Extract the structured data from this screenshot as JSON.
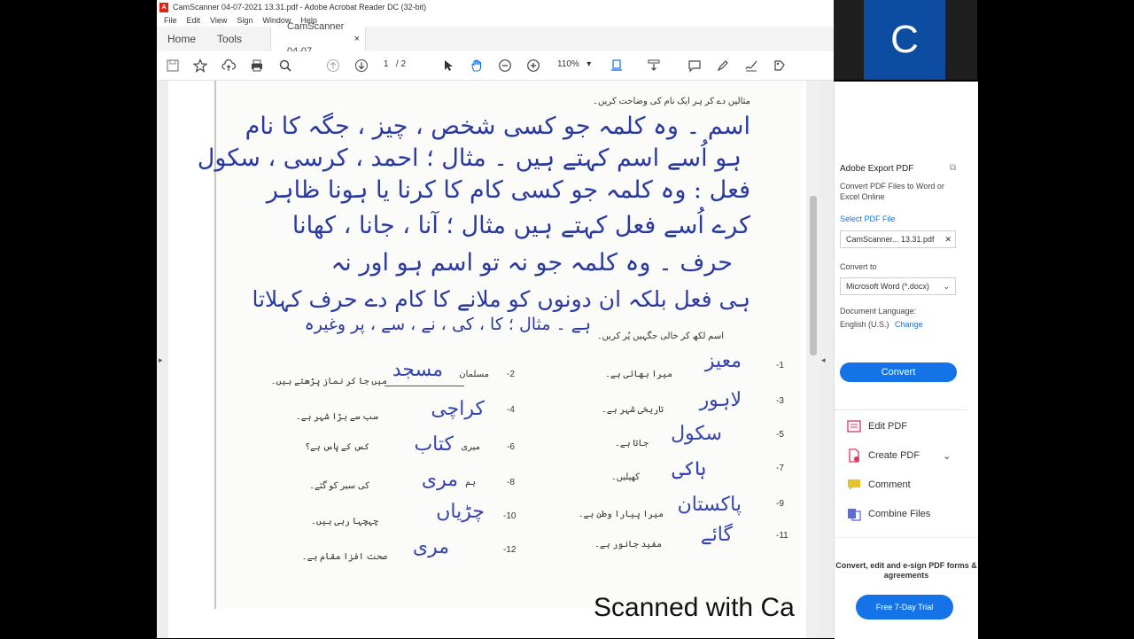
{
  "window": {
    "title": "CamScanner 04-07-2021 13.31.pdf - Adobe Acrobat Reader DC (32-bit)"
  },
  "menu": [
    "File",
    "Edit",
    "View",
    "Sign",
    "Window",
    "Help"
  ],
  "tabs": {
    "home": "Home",
    "tools": "Tools",
    "document": "CamScanner 04-07...",
    "close": "×"
  },
  "toolbar": {
    "page_current": "1",
    "page_total": "/ 2",
    "zoom": "110%"
  },
  "document": {
    "heading_line": "مثالیں دے کر ہر ایک نام کی وضاحت کریں۔",
    "handwriting": [
      "اسم ۔ وہ کلمہ جو کسی شخص ، چیز ، جگہ کا نام",
      "ہو اُسے اسم کہتے ہیں ۔ مثال ؛ احمد ، کرسی ، سکول",
      "فعل : وہ کلمہ جو کسی کام کا کرنا یا ہونا ظاہر",
      "کرے اُسے فعل کہتے ہیں مثال ؛ آنا ، جانا ، کھانا",
      "حرف ۔ وہ کلمہ جو نہ تو اسم ہو اور نہ",
      "ہی فعل بلکہ ان دونوں کو ملانے کا کام دے حرف کہلاتا",
      "ہے ۔ مثال ؛ کا ، کی ، نے ، سے ، پر وغیرہ"
    ],
    "section_heading": "اسم لکھ کر خالی جگہیں پُر کریں۔",
    "left_items": [
      {
        "num": "-2",
        "printed_before": "مسلمان",
        "answer": "مسجد",
        "printed_after": "میں جا کر نماز پڑھتے ہیں۔"
      },
      {
        "num": "-4",
        "printed_before": "",
        "answer": "کراچی",
        "printed_after": "سب سے بڑا شہر ہے۔"
      },
      {
        "num": "-6",
        "printed_before": "میری",
        "answer": "کتاب",
        "printed_after": "کس کے پاس ہے؟"
      },
      {
        "num": "-8",
        "printed_before": "ہم",
        "answer": "مری",
        "printed_after": "کی سیر کو گئے۔"
      },
      {
        "num": "-10",
        "printed_before": "",
        "answer": "چڑیاں",
        "printed_after": "چہچہا رہی ہیں۔"
      },
      {
        "num": "-12",
        "printed_before": "",
        "answer": "مری",
        "printed_after": "صحت افزا مقام ہے۔"
      }
    ],
    "right_items": [
      {
        "num": "-1",
        "answer": "معیز",
        "printed_after": "میرا بھائی ہے۔"
      },
      {
        "num": "-3",
        "answer": "لاہور",
        "printed_after": "تاریخی شہر ہے۔"
      },
      {
        "num": "-5",
        "answer": "سکول",
        "printed_after": "جاتا ہے۔"
      },
      {
        "num": "-7",
        "answer": "ہاکی",
        "printed_after": "کھیلیں۔"
      },
      {
        "num": "-9",
        "answer": "پاکستان",
        "printed_after": "میرا پیارا وطن ہے۔"
      },
      {
        "num": "-11",
        "answer": "گائے",
        "printed_after": "مفید جانور ہے۔"
      }
    ],
    "watermark": "Scanned with Ca"
  },
  "participants": {
    "initial": "C"
  },
  "sidepanel": {
    "title": "Adobe Export PDF",
    "description": "Convert PDF Files to Word or Excel Online",
    "select_label": "Select PDF File",
    "file_name": "CamScanner... 13.31.pdf",
    "convert_to_label": "Convert to",
    "format": "Microsoft Word (*.docx)",
    "language_label": "Document Language:",
    "language": "English (U.S.)",
    "change": "Change",
    "convert_button": "Convert",
    "tools": [
      "Edit PDF",
      "Create PDF",
      "Comment",
      "Combine Files"
    ],
    "promo": "Convert, edit and e-sign PDF forms & agreements",
    "trial_button": "Free 7-Day Trial"
  },
  "colors": {
    "accent": "#1473e6",
    "ink": "#2b3aa0",
    "pdf_red": "#e0241b",
    "avatar_blue": "#0c4da2"
  }
}
